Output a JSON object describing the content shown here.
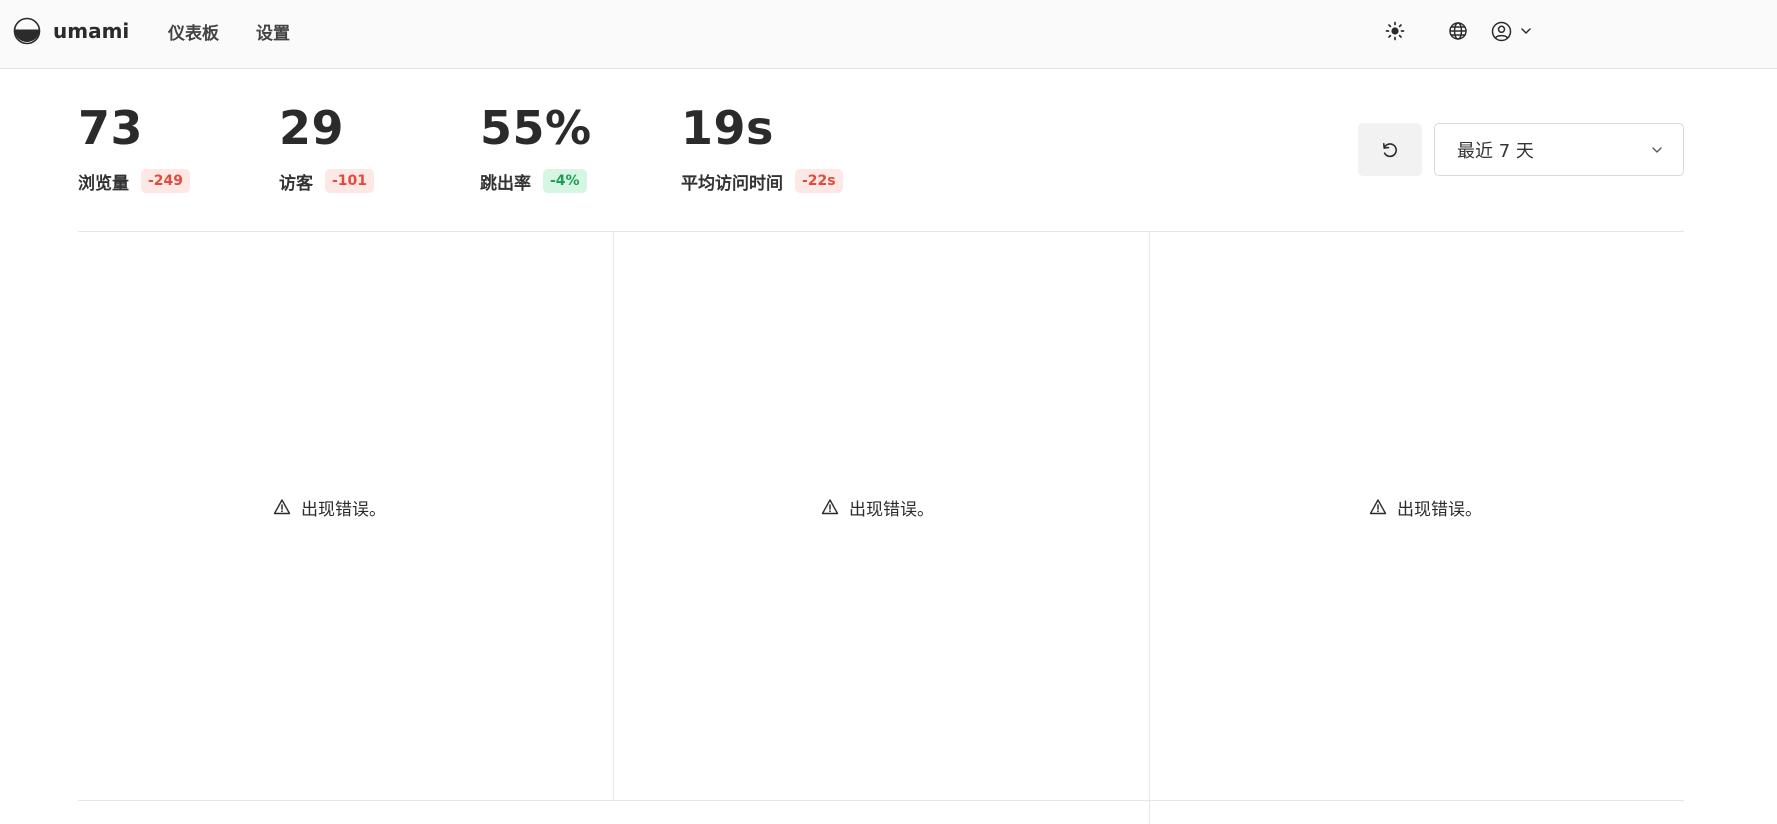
{
  "app": {
    "name": "umami"
  },
  "nav": {
    "items": [
      {
        "label": "仪表板"
      },
      {
        "label": "设置"
      }
    ]
  },
  "header_actions": {
    "theme_icon": "sun-icon",
    "language_icon": "globe-icon",
    "profile_icon": "user-circle-icon"
  },
  "stats": [
    {
      "value": "73",
      "label": "浏览量",
      "change": "-249",
      "trend": "negative"
    },
    {
      "value": "29",
      "label": "访客",
      "change": "-101",
      "trend": "negative"
    },
    {
      "value": "55%",
      "label": "跳出率",
      "change": "-4%",
      "trend": "positive"
    },
    {
      "value": "19s",
      "label": "平均访问时间",
      "change": "-22s",
      "trend": "negative"
    }
  ],
  "controls": {
    "refresh_icon": "refresh-icon",
    "date_range": "最近 7 天"
  },
  "panels": [
    {
      "error": "出现错误。"
    },
    {
      "error": "出现错误。"
    },
    {
      "error": "出现错误。"
    }
  ],
  "colors": {
    "negative_bg": "#fde8e6",
    "negative_text": "#e14b3c",
    "positive_bg": "#d6f5e3",
    "positive_text": "#1f9d57"
  }
}
